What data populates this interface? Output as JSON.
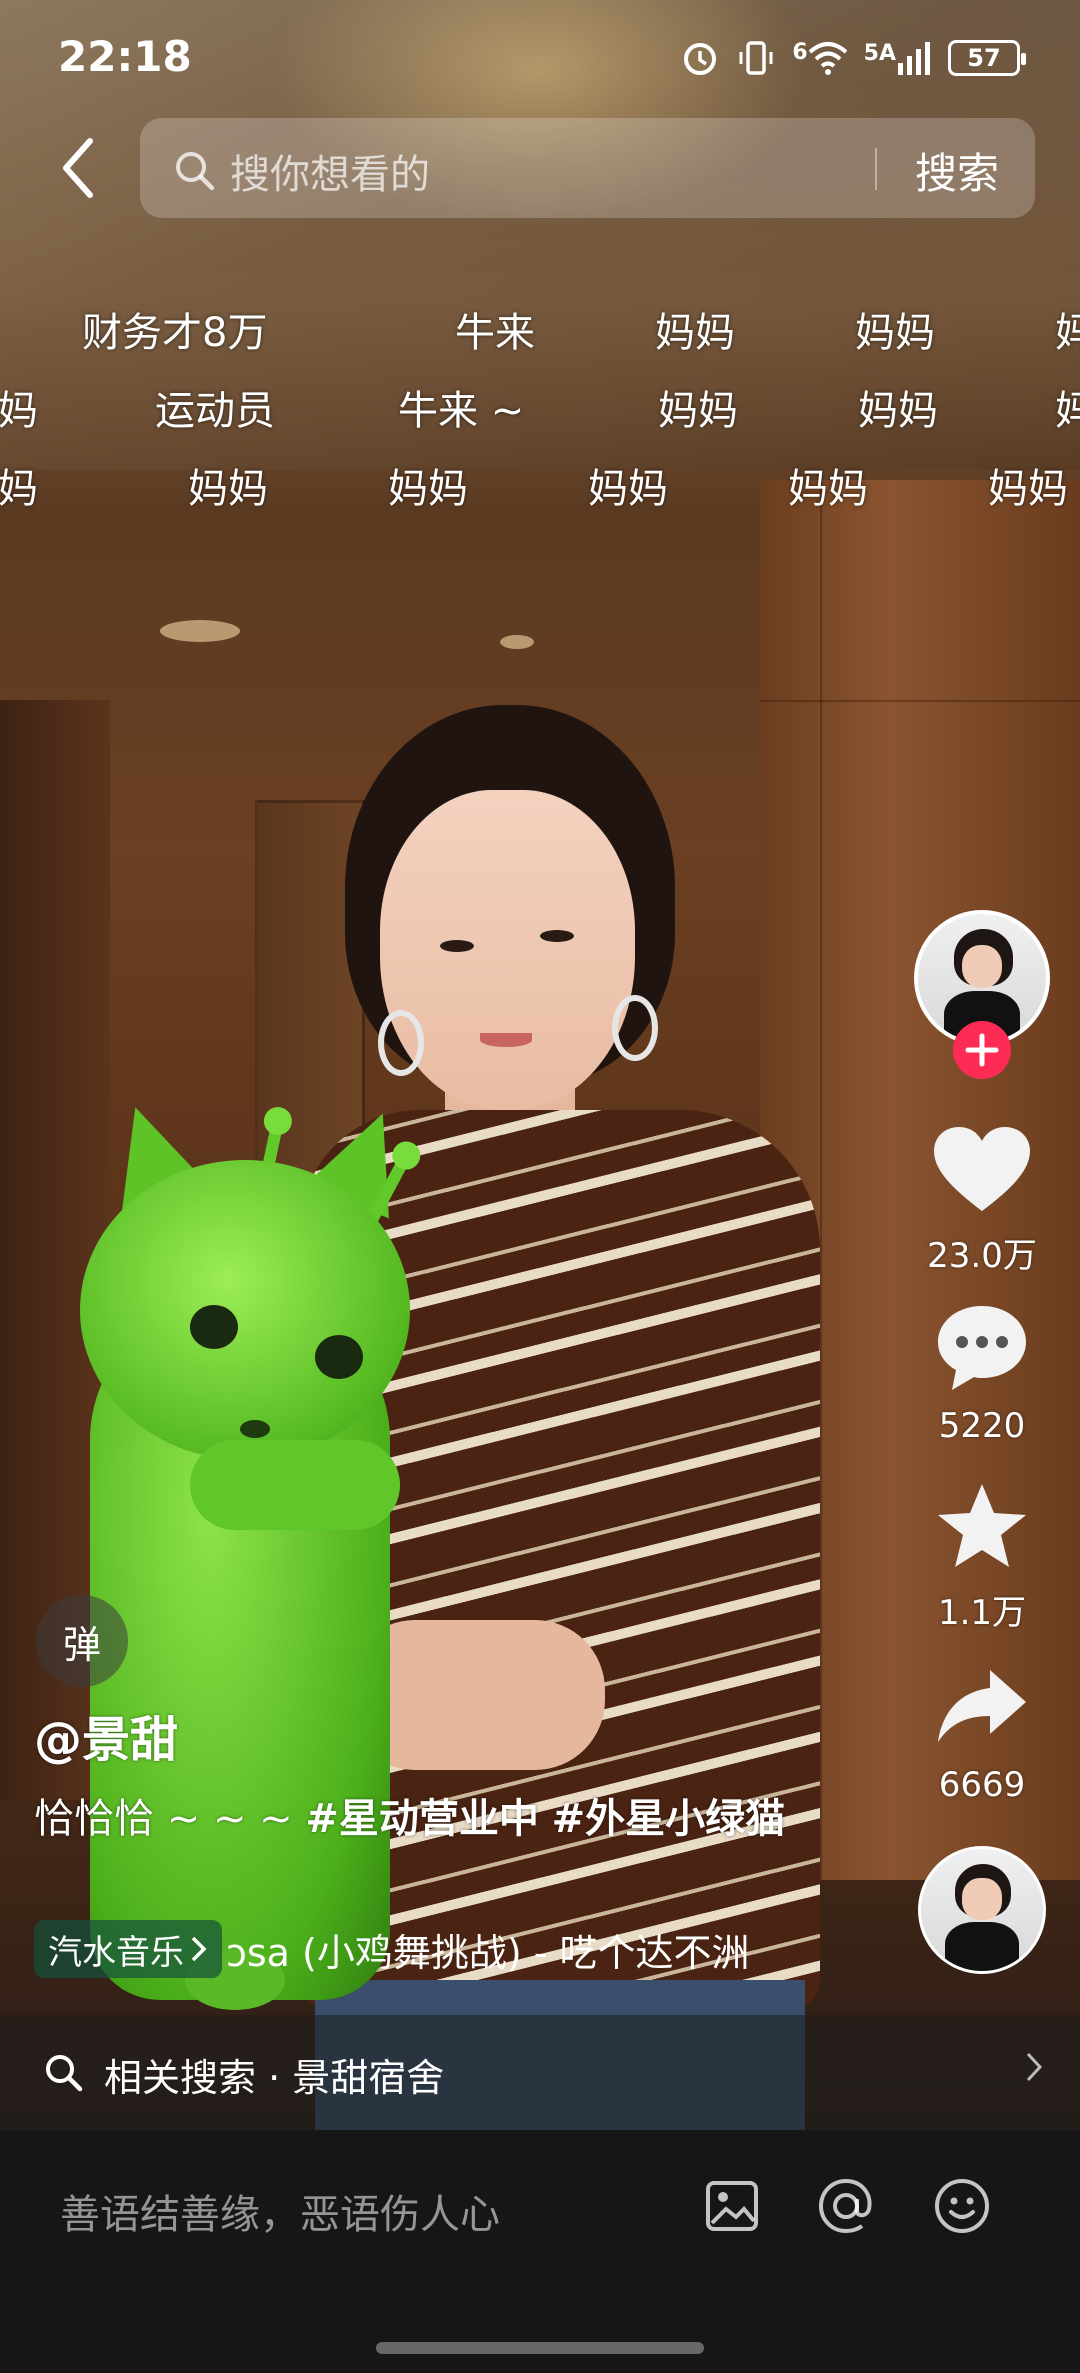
{
  "status_bar": {
    "time": "22:18",
    "battery": "57",
    "net_5g": "5A",
    "net_6": "6"
  },
  "search": {
    "placeholder": "搜你想看的",
    "button": "搜索"
  },
  "danmaku": [
    "财务才8万",
    "牛来",
    "妈妈",
    "妈妈",
    "妈",
    "妈",
    "运动员",
    "牛来 ~",
    "妈妈",
    "妈妈",
    "妈",
    "妈",
    "妈妈",
    "妈妈",
    "妈妈",
    "妈妈",
    "妈妈"
  ],
  "rail": {
    "likes": "23.0万",
    "comments": "5220",
    "favorites": "1.1万",
    "shares": "6669"
  },
  "video": {
    "danmu_toggle": "弹",
    "author": "@景甜",
    "caption_text": "恰恰恰 ~ ~ ~ ",
    "tags": [
      "#星动营业中",
      "#外星小绿猫"
    ],
    "music_source": "汽水音乐",
    "music_title": "ɔsa (小鸡舞挑战) - 呓个达不洲"
  },
  "related": {
    "text": "相关搜索 · 景甜宿舍"
  },
  "comment": {
    "placeholder": "善语结善缘，恶语伤人心"
  },
  "colors": {
    "accent_pink": "#fe2c55",
    "comment_bg": "#161616"
  }
}
